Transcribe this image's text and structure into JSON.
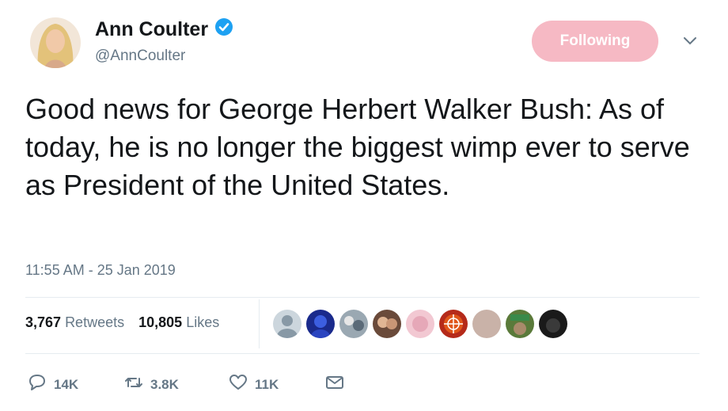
{
  "user": {
    "display_name": "Ann Coulter",
    "handle": "@AnnCoulter",
    "verified_icon": "verified-badge-icon"
  },
  "follow_button": {
    "label": "Following",
    "color": "#f6b9c4"
  },
  "tweet": {
    "text": "Good news for George Herbert Walker Bush: As of today, he is no longer the biggest wimp ever to serve as President of the United States.",
    "timestamp": "11:55 AM - 25 Jan 2019"
  },
  "stats": {
    "retweets_count": "3,767",
    "retweets_label": "Retweets",
    "likes_count": "10,805",
    "likes_label": "Likes"
  },
  "actions": {
    "reply_count": "14K",
    "retweet_count": "3.8K",
    "like_count": "11K"
  },
  "colors": {
    "text": "#14171a",
    "secondary": "#657786",
    "verified": "#1da1f2",
    "divider": "#e6ecf0"
  }
}
